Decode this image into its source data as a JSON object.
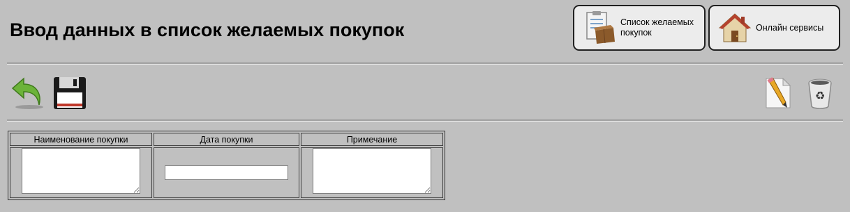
{
  "header": {
    "title": "Ввод данных в список желаемых покупок",
    "nav": [
      {
        "label_line1": "Список желаемых",
        "label_line2": "покупок",
        "icon": "clipboard-box-icon"
      },
      {
        "label": "Онлайн сервисы",
        "icon": "house-icon"
      }
    ]
  },
  "toolbar": {
    "back_icon": "back-arrow-icon",
    "save_icon": "floppy-disk-icon",
    "edit_icon": "pencil-document-icon",
    "delete_icon": "recycle-bin-icon"
  },
  "form": {
    "columns": [
      "Наименование покупки",
      "Дата покупки",
      "Примечание"
    ],
    "values": {
      "name": "",
      "date": "",
      "note": ""
    }
  },
  "colors": {
    "background": "#c0c0c0",
    "button_bg": "#ececec",
    "accent_green": "#5aa02c",
    "floppy_red": "#c0392b"
  }
}
